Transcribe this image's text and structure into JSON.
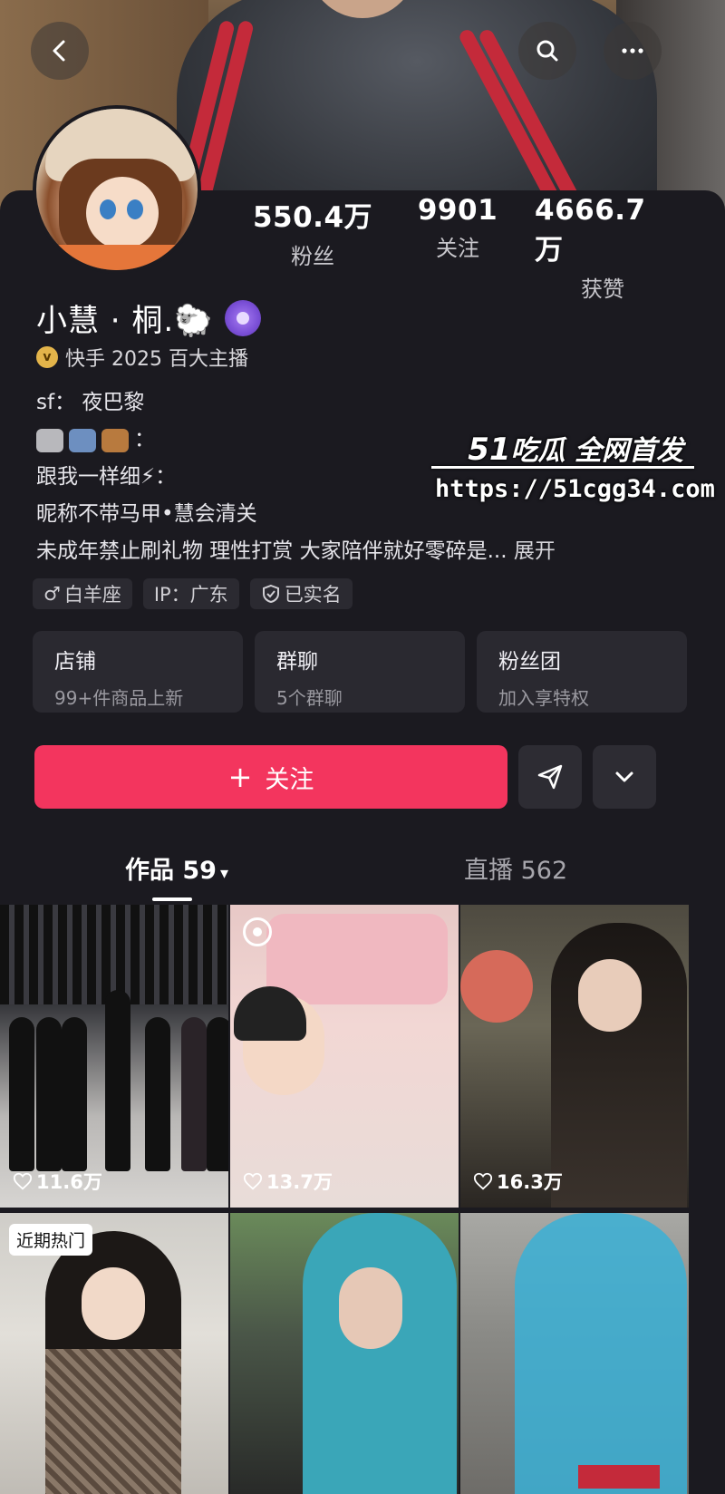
{
  "header": {
    "back_icon": "chevron-left-icon",
    "search_icon": "search-icon",
    "more_icon": "more-dots-icon"
  },
  "stats": [
    {
      "value": "550.4万",
      "label": "粉丝"
    },
    {
      "value": "9901",
      "label": "关注"
    },
    {
      "value": "4666.7万",
      "label": "获赞"
    }
  ],
  "profile": {
    "name": "小慧 · 桐.🐑",
    "anchor_badge_icon": "v",
    "anchor_text": "快手 2025 百大主播"
  },
  "bio": {
    "line1": "sf：  夜巴黎",
    "line2_suffix": "：",
    "line3": "跟我一样细⚡：",
    "line4": "昵称不带马甲•慧会清关",
    "line5": "未成年禁止刷礼物 理性打赏 大家陪伴就好零碎是...",
    "expand": "展开"
  },
  "tags": [
    {
      "icon": "♂",
      "label": "白羊座"
    },
    {
      "label": "IP：广东"
    },
    {
      "icon": "shield-icon",
      "label": "已实名"
    }
  ],
  "tiles": [
    {
      "title": "店铺",
      "sub": "99+件商品上新"
    },
    {
      "title": "群聊",
      "sub": "5个群聊"
    },
    {
      "title": "粉丝团",
      "sub": "加入享特权"
    }
  ],
  "actions": {
    "follow_plus": "+",
    "follow_label": "关注",
    "share_icon": "send-icon",
    "dropdown_icon": "chevron-down-icon"
  },
  "tabs": {
    "works_label": "作品 59",
    "works_arrow": "▾",
    "live_label": "直播 562"
  },
  "videos": [
    {
      "likes": "11.6万"
    },
    {
      "likes": "13.7万"
    },
    {
      "likes": "16.3万"
    },
    {
      "badge": "近期热门"
    },
    {},
    {}
  ],
  "watermark": {
    "brand_51": "51",
    "brand_rest": "吃瓜 全网首发",
    "url": "https://51cgg34.com"
  },
  "colors": {
    "follow_button": "#f3355e",
    "background": "#1b1a20",
    "tile_bg": "#2a2930"
  }
}
